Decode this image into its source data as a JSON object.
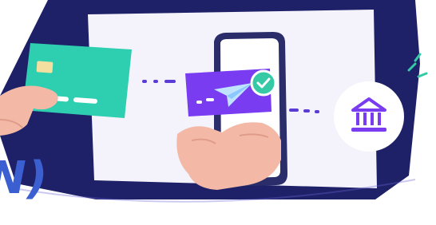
{
  "caption": {
    "fragment_text": "N)"
  },
  "colors": {
    "card": "#2ecfb0",
    "card_chip": "#f3dfa0",
    "phone_frame": "#2a2d6a",
    "screen_badge": "#7a3cf0",
    "check_badge": "#35c9a6",
    "bank_icon": "#7a3cf0",
    "connector": "#5a3bd6",
    "dark_backdrop": "#1f2168",
    "panel": "#f4f3fb",
    "skin": "#f3b9a6",
    "caption": "#3b5fd1"
  },
  "icons": {
    "card": "credit-card-icon",
    "phone": "smartphone-icon",
    "send": "paper-plane-icon",
    "check": "check-badge-icon",
    "bank": "bank-icon"
  }
}
